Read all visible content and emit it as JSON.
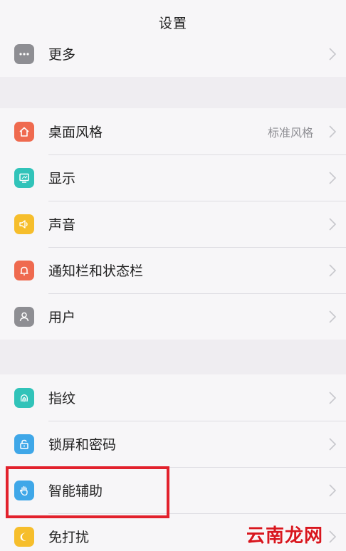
{
  "header": {
    "title": "设置"
  },
  "groups": [
    {
      "items": [
        {
          "label": "更多",
          "icon": "more-icon",
          "color": "#8e8e93"
        }
      ]
    },
    {
      "items": [
        {
          "label": "桌面风格",
          "value": "标准风格",
          "icon": "home-icon",
          "color": "#ef6a4f"
        },
        {
          "label": "显示",
          "icon": "display-icon",
          "color": "#31c3b9"
        },
        {
          "label": "声音",
          "icon": "speaker-icon",
          "color": "#f6be2c"
        },
        {
          "label": "通知栏和状态栏",
          "icon": "bell-icon",
          "color": "#ef6a4f"
        },
        {
          "label": "用户",
          "icon": "user-icon",
          "color": "#8e8e93"
        }
      ]
    },
    {
      "items": [
        {
          "label": "指纹",
          "icon": "fingerprint-icon",
          "color": "#31c3b9"
        },
        {
          "label": "锁屏和密码",
          "icon": "lock-icon",
          "color": "#3fa7e8"
        },
        {
          "label": "智能辅助",
          "icon": "hand-icon",
          "color": "#3fa7e8"
        },
        {
          "label": "免打扰",
          "icon": "moon-icon",
          "color": "#f6be2c"
        }
      ]
    }
  ],
  "colors": {
    "highlight": "#e2212c",
    "watermark": "#d8161e"
  },
  "watermark": {
    "text": "云南龙网"
  }
}
